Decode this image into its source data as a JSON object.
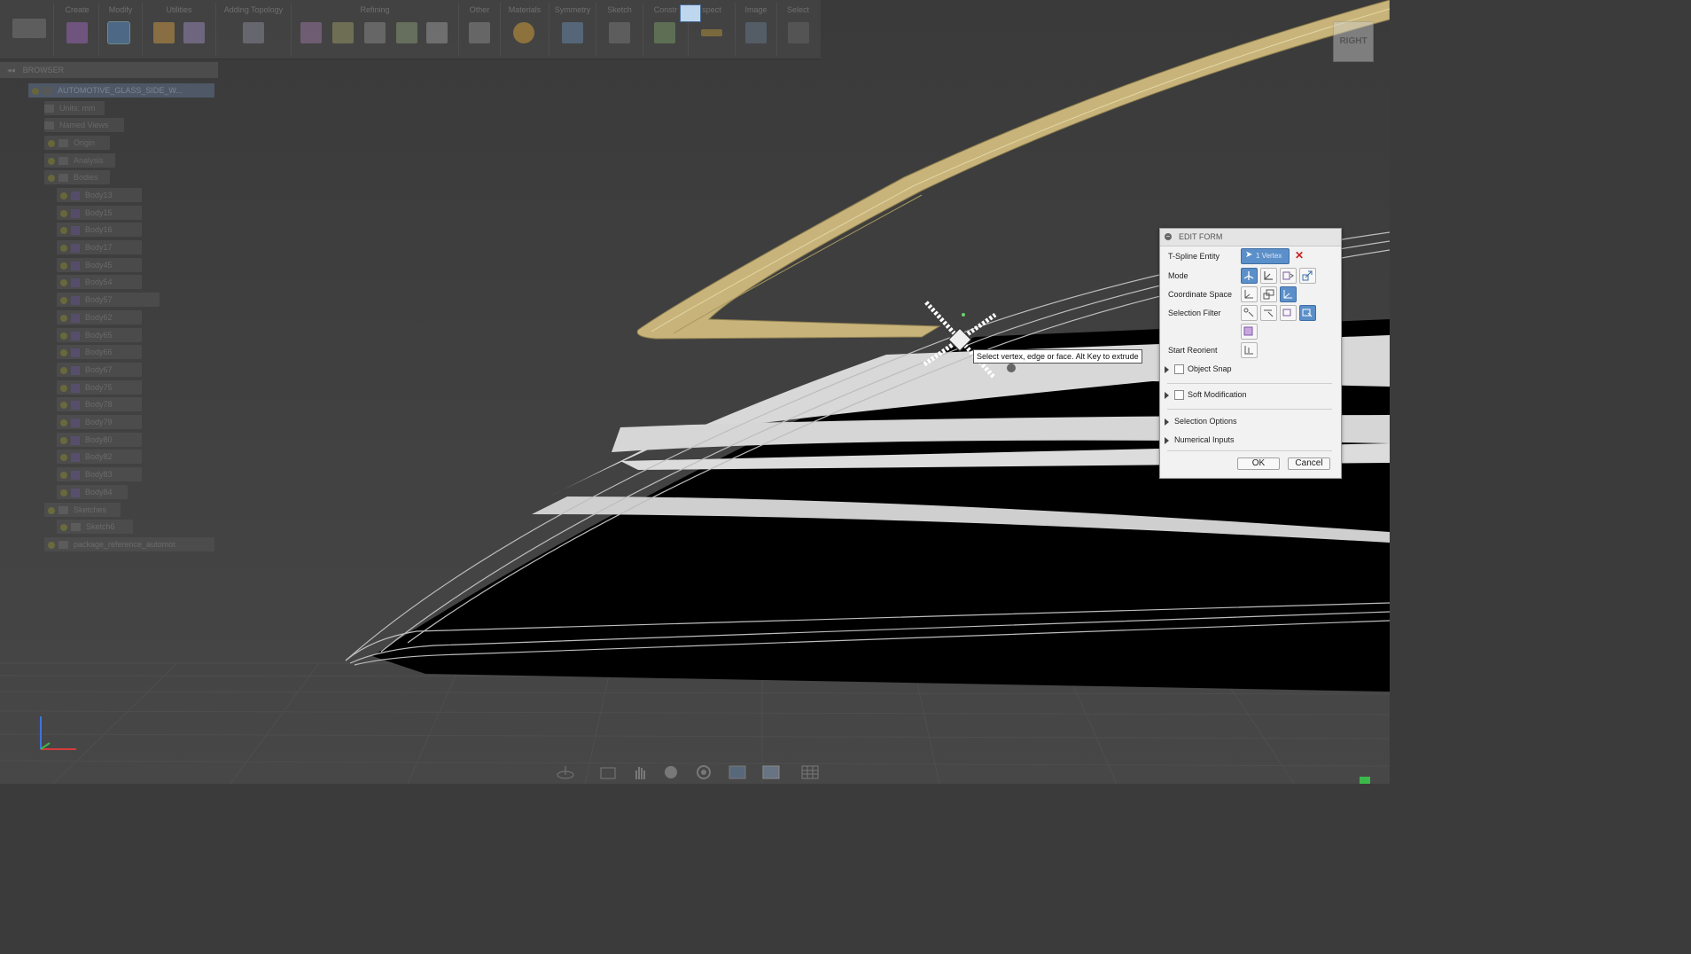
{
  "toolbar": {
    "groups": [
      {
        "label": "Create"
      },
      {
        "label": "Modify"
      },
      {
        "label": "Utilities"
      },
      {
        "label": "Adding Topology"
      },
      {
        "label": "Refining"
      },
      {
        "label": "Other"
      },
      {
        "label": "Materials"
      },
      {
        "label": "Symmetry"
      },
      {
        "label": "Sketch"
      },
      {
        "label": "Constr"
      },
      {
        "label": "spect"
      },
      {
        "label": "Image"
      },
      {
        "label": "Select"
      }
    ]
  },
  "browser": {
    "title": "BROWSER",
    "root": "AUTOMOTIVE_GLASS_SIDE_W...",
    "items": [
      {
        "label": "Units: mm"
      },
      {
        "label": "Named Views"
      },
      {
        "label": "Origin"
      },
      {
        "label": "Analysis"
      },
      {
        "label": "Bodies"
      },
      {
        "label": "Body13"
      },
      {
        "label": "Body15"
      },
      {
        "label": "Body16"
      },
      {
        "label": "Body17"
      },
      {
        "label": "Body45"
      },
      {
        "label": "Body54"
      },
      {
        "label": "Body57"
      },
      {
        "label": "Body62"
      },
      {
        "label": "Body65"
      },
      {
        "label": "Body66"
      },
      {
        "label": "Body67"
      },
      {
        "label": "Body75"
      },
      {
        "label": "Body78"
      },
      {
        "label": "Body79"
      },
      {
        "label": "Body80"
      },
      {
        "label": "Body82"
      },
      {
        "label": "Body83"
      },
      {
        "label": "Body84"
      },
      {
        "label": "Sketches"
      },
      {
        "label": "Sketch6"
      },
      {
        "label": "package_reference_automot"
      }
    ]
  },
  "viewcube": {
    "label": "RIGHT"
  },
  "edit_form": {
    "title": "EDIT FORM",
    "rows": {
      "tspline_entity": "T-Spline Entity",
      "tspline_value": "1 Vertex",
      "mode": "Mode",
      "coordinate_space": "Coordinate Space",
      "selection_filter": "Selection Filter",
      "start_reorient": "Start Reorient",
      "object_snap": "Object Snap",
      "soft_modification": "Soft Modification",
      "selection_options": "Selection Options",
      "numerical_inputs": "Numerical Inputs"
    },
    "ok": "OK",
    "cancel": "Cancel"
  },
  "tooltip": "Select vertex, edge or face. Alt Key to extrude",
  "colors": {
    "background": "#3b3b3b",
    "highlight_body": "#c8b47a",
    "selected_button": "#5b8fc9",
    "delete_x": "#cc2222"
  }
}
